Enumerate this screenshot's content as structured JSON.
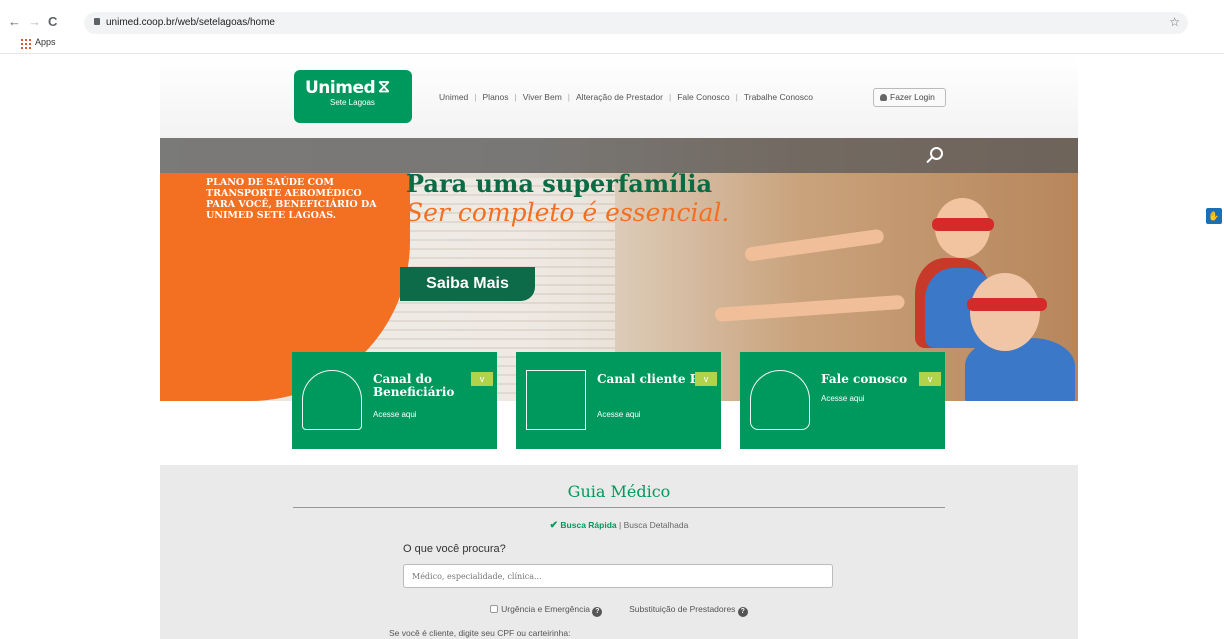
{
  "browser": {
    "back": "←",
    "forward": "→",
    "reload": "C",
    "url": "unimed.coop.br/web/setelagoas/home",
    "bookmark_star": "☆",
    "apps_label": "Apps",
    "extension_icon": "accessibility-icon"
  },
  "header": {
    "logo_name": "Unimed",
    "logo_sub": "Sete Lagoas",
    "menu": [
      "Unimed",
      "Planos",
      "Viver Bem",
      "Alteração de Prestador",
      "Fale Conosco",
      "Trabalhe Conosco"
    ],
    "login_label": "Fazer Login"
  },
  "hero": {
    "promo": "PLANO DE SAÚDE COM TRANSPORTE AEROMÉDICO PARA VOCÊ, BENEFICIÁRIO DA UNIMED SETE LAGOAS.",
    "headline": "Para uma superfamília",
    "tagline": "Ser completo é essencial.",
    "cta": "Saiba Mais",
    "accent_orange": "#f36f21",
    "brand_green": "#00995d"
  },
  "cards": [
    {
      "title": "Canal do Beneficiário",
      "sub": "Acesse aqui",
      "icon": "family-icon",
      "chevron": "v"
    },
    {
      "title": "Canal cliente PJ",
      "sub": "Acesse aqui",
      "icon": "factory-icon",
      "chevron": "v"
    },
    {
      "title": "Fale conosco",
      "sub": "Acesse aqui",
      "icon": "woman-icon",
      "chevron": "v"
    }
  ],
  "guia": {
    "title": "Guia Médico",
    "tab_active": "Busca Rápida",
    "tab_other": "Busca Detalhada",
    "question": "O que você procura?",
    "placeholder": "Médico, especialidade, clínica...",
    "opt_urgencia": "Urgência e Emergência",
    "opt_substituicao": "Substituição de Prestadores",
    "cpf_hint": "Se você é cliente, digite seu CPF ou carteirinha:"
  }
}
